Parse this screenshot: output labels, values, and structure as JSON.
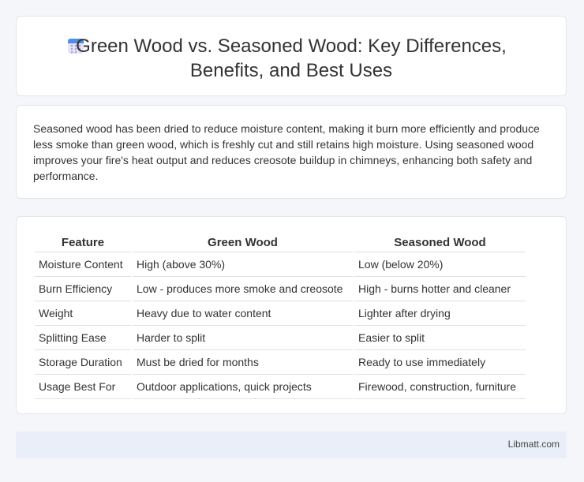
{
  "header": {
    "title_line1": "Green Wood vs. Seasoned Wood: Key Differences,",
    "title_line2": "Benefits, and Best Uses",
    "icon": "calendar-icon"
  },
  "intro": {
    "text": "Seasoned wood has been dried to reduce moisture content, making it burn more efficiently and produce less smoke than green wood, which is freshly cut and still retains high moisture. Using seasoned wood improves your fire's heat output and reduces creosote buildup in chimneys, enhancing both safety and performance."
  },
  "table": {
    "headers": [
      "Feature",
      "Green Wood",
      "Seasoned Wood"
    ],
    "rows": [
      [
        "Moisture Content",
        "High (above 30%)",
        "Low (below 20%)"
      ],
      [
        "Burn Efficiency",
        "Low - produces more smoke and creosote",
        "High - burns hotter and cleaner"
      ],
      [
        "Weight",
        "Heavy due to water content",
        "Lighter after drying"
      ],
      [
        "Splitting Ease",
        "Harder to split",
        "Easier to split"
      ],
      [
        "Storage Duration",
        "Must be dried for months",
        "Ready to use immediately"
      ],
      [
        "Usage Best For",
        "Outdoor applications, quick projects",
        "Firewood, construction, furniture"
      ]
    ]
  },
  "footer": {
    "brand": "Libmatt.com"
  }
}
